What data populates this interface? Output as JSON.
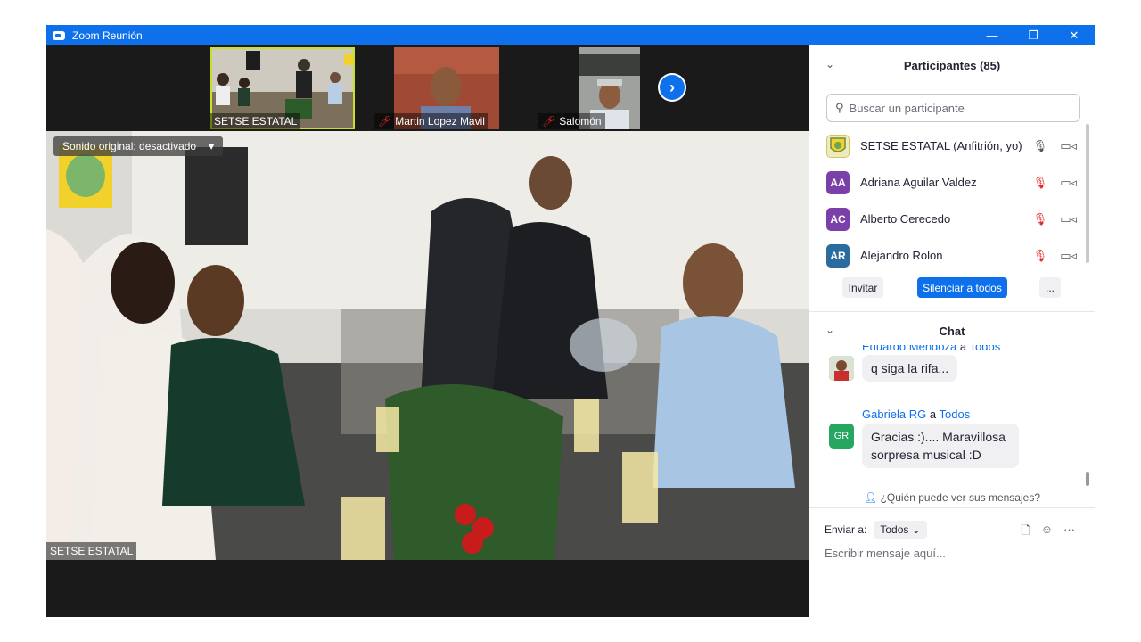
{
  "window": {
    "title": "Zoom Reunión",
    "minimize": "—",
    "restore": "❐",
    "close": "✕"
  },
  "thumbnails": [
    {
      "name": "SETSE ESTATAL",
      "muted": false
    },
    {
      "name": "Martin Lopez Mavil",
      "muted": true
    },
    {
      "name": "Salomón",
      "muted": true
    }
  ],
  "next_arrow": "›",
  "main_video": {
    "sound_label": "Sonido original: desactivado",
    "sound_caret": "▾",
    "speaker_name": "SETSE ESTATAL"
  },
  "participants": {
    "title": "Participantes (85)",
    "collapse": "⌄",
    "search_placeholder": "Buscar un participante",
    "search_icon": "⚲",
    "list": [
      {
        "initials": "",
        "name": "SETSE ESTATAL (Anfitrión, yo)",
        "color": "#e7d33c",
        "muted": false
      },
      {
        "initials": "AA",
        "name": "Adriana Aguilar Valdez",
        "color": "#7b3fa8",
        "muted": true
      },
      {
        "initials": "AC",
        "name": "Alberto Cerecedo",
        "color": "#7b3fa8",
        "muted": true
      },
      {
        "initials": "AR",
        "name": "Alejandro Rolon",
        "color": "#2b6c9e",
        "muted": true
      }
    ],
    "invite_label": "Invitar",
    "mute_all_label": "Silenciar a todos",
    "more_label": "..."
  },
  "chat": {
    "title": "Chat",
    "collapse": "⌄",
    "messages": [
      {
        "sender": "Eduardo Mendoza",
        "to_word": "a",
        "to": "Todos",
        "text": "q siga la rifa...",
        "avatar_initials": "",
        "avatar_color": "#b7453c"
      },
      {
        "sender": "Gabriela RG",
        "to_word": "a",
        "to": "Todos",
        "text": "Gracias :).... Maravillosa sorpresa musical :D",
        "avatar_initials": "GR",
        "avatar_color": "#25a661"
      }
    ],
    "who_can_see": "¿Quién puede ver sus mensajes?",
    "send_to_label": "Enviar a:",
    "send_to_value": "Todos",
    "send_to_caret": "⌄",
    "compose_placeholder": "Escribir mensaje aquí...",
    "file_icon": "🗋",
    "emoji_icon": "☺",
    "more_icon": "···"
  },
  "accent_color": "#0e71eb"
}
